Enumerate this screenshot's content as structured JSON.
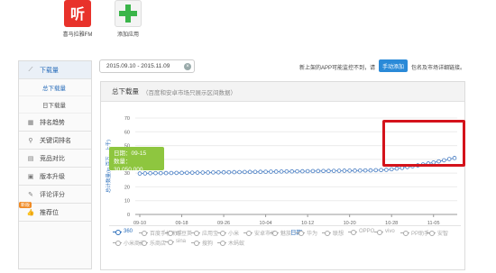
{
  "apps": [
    {
      "label": "喜马拉雅FM",
      "icon": "ximalaya-fm-icon"
    },
    {
      "label": "添加应用",
      "icon": "plus-icon"
    }
  ],
  "sidebar": {
    "items": [
      {
        "label": "下载量",
        "icon": "chart-icon"
      },
      {
        "label": "排名趋势",
        "icon": "grid-icon"
      },
      {
        "label": "关键词排名",
        "icon": "search-icon"
      },
      {
        "label": "竞品对比",
        "icon": "compare-icon"
      },
      {
        "label": "版本升级",
        "icon": "version-icon"
      },
      {
        "label": "评论评分",
        "icon": "comment-icon"
      },
      {
        "label": "推荐位",
        "icon": "thumb-icon",
        "badge": "新版"
      }
    ],
    "sub_items": [
      "总下载量",
      "日下载量"
    ]
  },
  "date_range": "2015.09.10 - 2015.11.09",
  "notice": {
    "text": "新上架的APP可能监控不到，请",
    "button": "手动添加",
    "suffix": "包名及市场详细链接。"
  },
  "panel": {
    "title": "总下载量",
    "subtitle": "（百度和安卓市场只展示区间数据）"
  },
  "tooltip": {
    "date_line": "日期：09-15",
    "value_line": "数量：30,050,000"
  },
  "chart_data": {
    "type": "line",
    "xlabel": "日期",
    "ylabel": "总计数量(in 百万，上千)",
    "yticks": [
      0,
      10,
      20,
      30,
      40,
      50,
      60,
      70
    ],
    "xticks": [
      "09-10",
      "09-18",
      "09-26",
      "10-04",
      "10-12",
      "10-20",
      "10-28",
      "11-05"
    ],
    "series": [
      {
        "name": "360",
        "x_start": "09-10",
        "x_end": "11-09",
        "values": [
          29.7,
          29.8,
          29.9,
          30.0,
          30.0,
          30.05,
          30.1,
          30.15,
          30.2,
          30.25,
          30.3,
          30.35,
          30.4,
          30.45,
          30.5,
          30.55,
          30.6,
          30.65,
          30.7,
          30.75,
          30.8,
          30.85,
          30.9,
          30.95,
          31.0,
          31.05,
          31.1,
          31.15,
          31.2,
          31.25,
          31.3,
          31.35,
          31.4,
          31.45,
          31.5,
          31.55,
          31.6,
          31.65,
          31.7,
          31.75,
          31.8,
          31.85,
          31.9,
          31.95,
          32.0,
          32.1,
          32.2,
          32.4,
          32.8,
          33.3,
          33.8,
          34.4,
          35.0,
          35.6,
          36.3,
          37.0,
          37.7,
          38.5,
          39.3,
          40.2,
          41.0
        ]
      }
    ],
    "ylim": [
      0,
      70
    ]
  },
  "legend": [
    "360",
    "百度手机助手",
    "豌豆荚",
    "应用宝",
    "小米",
    "安卓市场",
    "魅族",
    "华为",
    "联想",
    "OPPO",
    "vivo",
    "PP助手",
    "安智",
    "小米商店",
    "乐商店",
    "sina",
    "搜狗",
    "木蚂蚁"
  ]
}
